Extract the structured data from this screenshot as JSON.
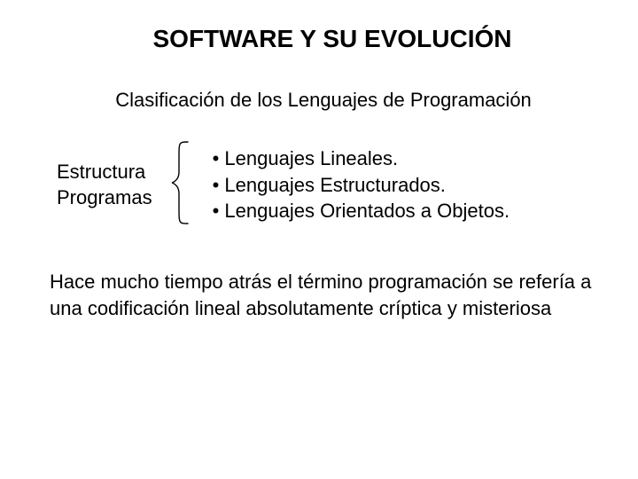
{
  "title": "SOFTWARE Y SU EVOLUCIÓN",
  "subtitle": "Clasificación de los Lenguajes de Programación",
  "left_label": {
    "line1": "Estructura",
    "line2": "Programas"
  },
  "bullets": {
    "item1": "Lenguajes Lineales.",
    "item2": "Lenguajes Estructurados.",
    "item3": "Lenguajes Orientados a Objetos."
  },
  "paragraph": "Hace mucho tiempo atrás el término programación se refería a una codificación lineal absolutamente críptica y misteriosa"
}
